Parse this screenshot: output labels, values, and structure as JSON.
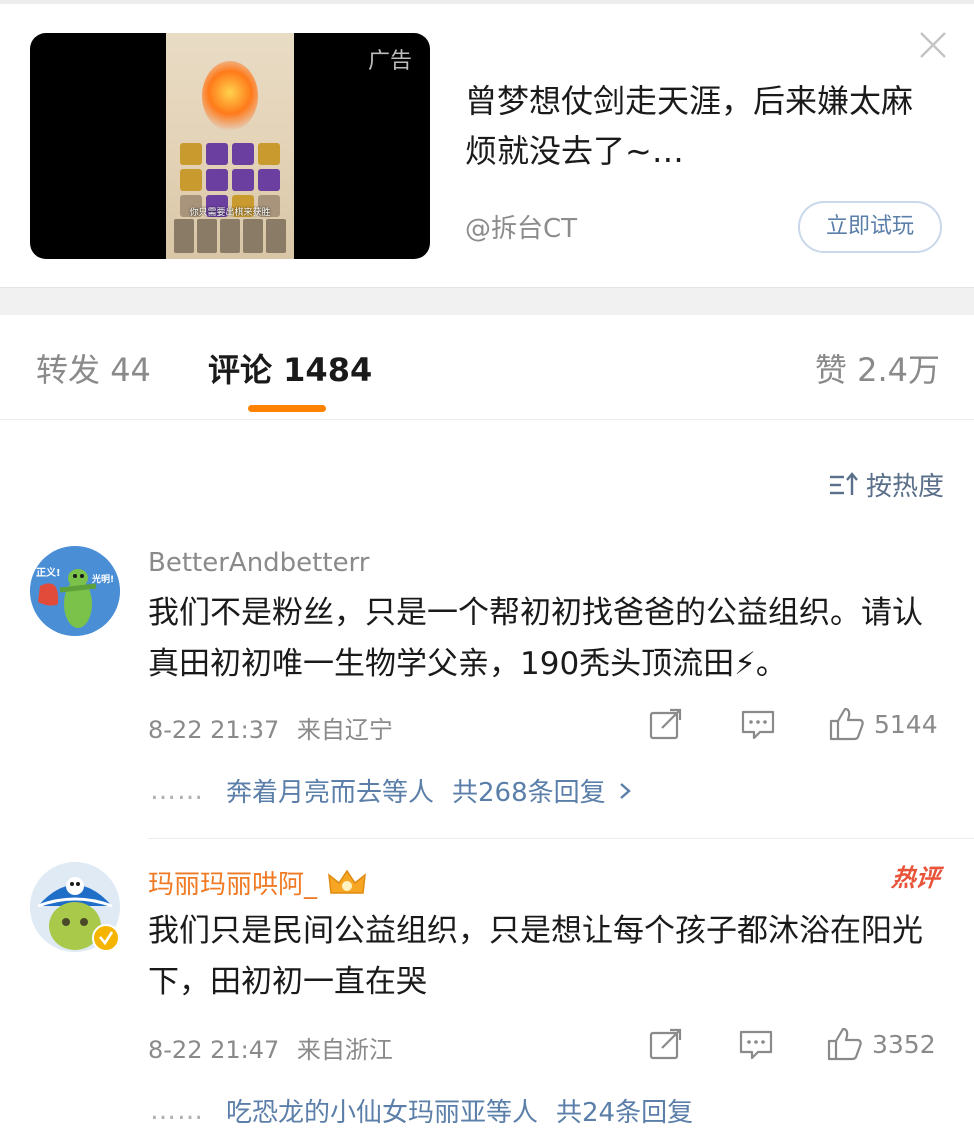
{
  "ad": {
    "label": "广告",
    "title": "曾梦想仗剑走天涯，后来嫌太麻烦就没去了~…",
    "author": "@拆台CT",
    "cta_label": "立即试玩",
    "thumbnail_caption": "你只需要出棋来获胜"
  },
  "tabs": {
    "repost": {
      "label": "转发",
      "count": "44"
    },
    "comments": {
      "label": "评论",
      "count": "1484"
    },
    "likes": {
      "label": "赞",
      "count": "2.4万"
    }
  },
  "sort_label": "按热度",
  "comments": [
    {
      "user": "BetterAndbetterr",
      "avatar_text_left": "正义!",
      "avatar_text_right": "光明!",
      "text": "我们不是粉丝，只是一个帮初初找爸爸的公益组织。请认真田初初唯一生物学父亲，190秃头顶流田⚡。",
      "time": "8-22 21:37",
      "location": "来自辽宁",
      "likes": "5144",
      "reply_preview": "奔着月亮而去等人",
      "reply_total": "共268条回复",
      "name_color": "#8a8a8a"
    },
    {
      "user": "玛丽玛丽哄阿_",
      "badge": "热评",
      "text": "我们只是民间公益组织，只是想让每个孩子都沐浴在阳光下，田初初一直在哭",
      "time": "8-22 21:47",
      "location": "来自浙江",
      "likes": "3352",
      "reply_preview": "吃恐龙的小仙女玛丽亚等人",
      "reply_total": "共24条回复",
      "name_color": "#f07a24"
    }
  ],
  "colors": {
    "accent": "#ff8200",
    "link": "#5b7fa9",
    "hot": "#e8533a",
    "muted": "#8a8a8a"
  },
  "icons": [
    "close-icon",
    "sort-icon",
    "repost-icon",
    "comment-icon",
    "like-icon",
    "chevron-right-icon",
    "verified-icon",
    "crown-icon"
  ]
}
